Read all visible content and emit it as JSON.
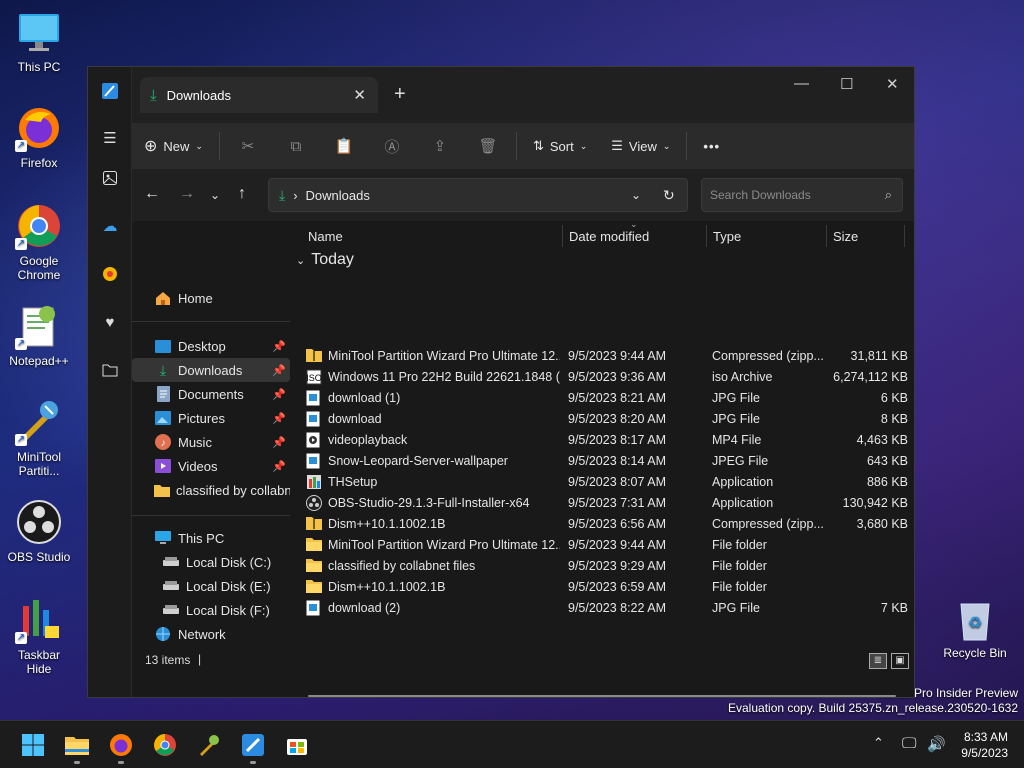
{
  "desktop": {
    "icons": [
      {
        "label": "This PC",
        "icon": "computer-icon"
      },
      {
        "label": "Firefox",
        "icon": "firefox-icon"
      },
      {
        "label": "Google Chrome",
        "icon": "chrome-icon"
      },
      {
        "label": "Notepad++",
        "icon": "notepad-icon"
      },
      {
        "label": "MiniTool Partiti...",
        "icon": "minitool-icon"
      },
      {
        "label": "OBS Studio",
        "icon": "obs-icon"
      },
      {
        "label": "Taskbar Hide",
        "icon": "taskbar-hide-icon"
      }
    ],
    "recycle_bin": "Recycle Bin",
    "watermark_line1": "ws 11 Pro Insider Preview",
    "watermark_line2": "Evaluation copy. Build 25375.zn_release.230520-1632"
  },
  "window": {
    "tab_title": "Downloads",
    "new_tab_symbol": "+",
    "toolbar": {
      "new_label": "New",
      "sort_label": "Sort",
      "view_label": "View",
      "more_label": "•••"
    },
    "address": {
      "path": "Downloads",
      "search_placeholder": "Search Downloads"
    },
    "nav": {
      "home": "Home",
      "quick": [
        {
          "label": "Desktop",
          "pinned": true
        },
        {
          "label": "Downloads",
          "pinned": true
        },
        {
          "label": "Documents",
          "pinned": true
        },
        {
          "label": "Pictures",
          "pinned": true
        },
        {
          "label": "Music",
          "pinned": true
        },
        {
          "label": "Videos",
          "pinned": true
        },
        {
          "label": "classified by collabne",
          "pinned": false
        }
      ],
      "this_pc": "This PC",
      "drives": [
        "Local Disk (C:)",
        "Local Disk (E:)",
        "Local Disk (F:)"
      ],
      "network": "Network"
    },
    "columns": {
      "name": "Name",
      "date": "Date modified",
      "type": "Type",
      "size": "Size"
    },
    "group_label": "Today",
    "files": [
      {
        "name": "MiniTool Partition Wizard Pro Ultimate 12...",
        "date": "9/5/2023 9:44 AM",
        "type": "Compressed (zipp...",
        "size": "31,811 KB",
        "icon": "zip"
      },
      {
        "name": "Windows 11 Pro 22H2 Build 22621.1848 (...",
        "date": "9/5/2023 9:36 AM",
        "type": "iso Archive",
        "size": "6,274,112 KB",
        "icon": "iso"
      },
      {
        "name": "download (1)",
        "date": "9/5/2023 8:21 AM",
        "type": "JPG File",
        "size": "6 KB",
        "icon": "img"
      },
      {
        "name": "download",
        "date": "9/5/2023 8:20 AM",
        "type": "JPG File",
        "size": "8 KB",
        "icon": "img"
      },
      {
        "name": "videoplayback",
        "date": "9/5/2023 8:17 AM",
        "type": "MP4 File",
        "size": "4,463 KB",
        "icon": "video"
      },
      {
        "name": "Snow-Leopard-Server-wallpaper",
        "date": "9/5/2023 8:14 AM",
        "type": "JPEG File",
        "size": "643 KB",
        "icon": "img"
      },
      {
        "name": "THSetup",
        "date": "9/5/2023 8:07 AM",
        "type": "Application",
        "size": "886 KB",
        "icon": "app"
      },
      {
        "name": "OBS-Studio-29.1.3-Full-Installer-x64",
        "date": "9/5/2023 7:31 AM",
        "type": "Application",
        "size": "130,942 KB",
        "icon": "obs"
      },
      {
        "name": "Dism++10.1.1002.1B",
        "date": "9/5/2023 6:56 AM",
        "type": "Compressed (zipp...",
        "size": "3,680 KB",
        "icon": "zip"
      },
      {
        "name": "MiniTool Partition Wizard Pro Ultimate 12...",
        "date": "9/5/2023 9:44 AM",
        "type": "File folder",
        "size": "",
        "icon": "folder"
      },
      {
        "name": "classified by collabnet files",
        "date": "9/5/2023 9:29 AM",
        "type": "File folder",
        "size": "",
        "icon": "folder"
      },
      {
        "name": "Dism++10.1.1002.1B",
        "date": "9/5/2023 6:59 AM",
        "type": "File folder",
        "size": "",
        "icon": "folder"
      },
      {
        "name": "download (2)",
        "date": "9/5/2023 8:22 AM",
        "type": "JPG File",
        "size": "7 KB",
        "icon": "img"
      }
    ],
    "status": {
      "items_count": "13 items",
      "separator": "|"
    }
  },
  "taskbar": {
    "time": "8:33 AM",
    "date": "9/5/2023",
    "apps": [
      "start",
      "file-explorer",
      "firefox",
      "chrome",
      "notepad-plus",
      "paint",
      "store"
    ]
  },
  "colors": {
    "accent": "#1f9bde",
    "folder": "#f2c24b",
    "window_bg": "#191919"
  }
}
